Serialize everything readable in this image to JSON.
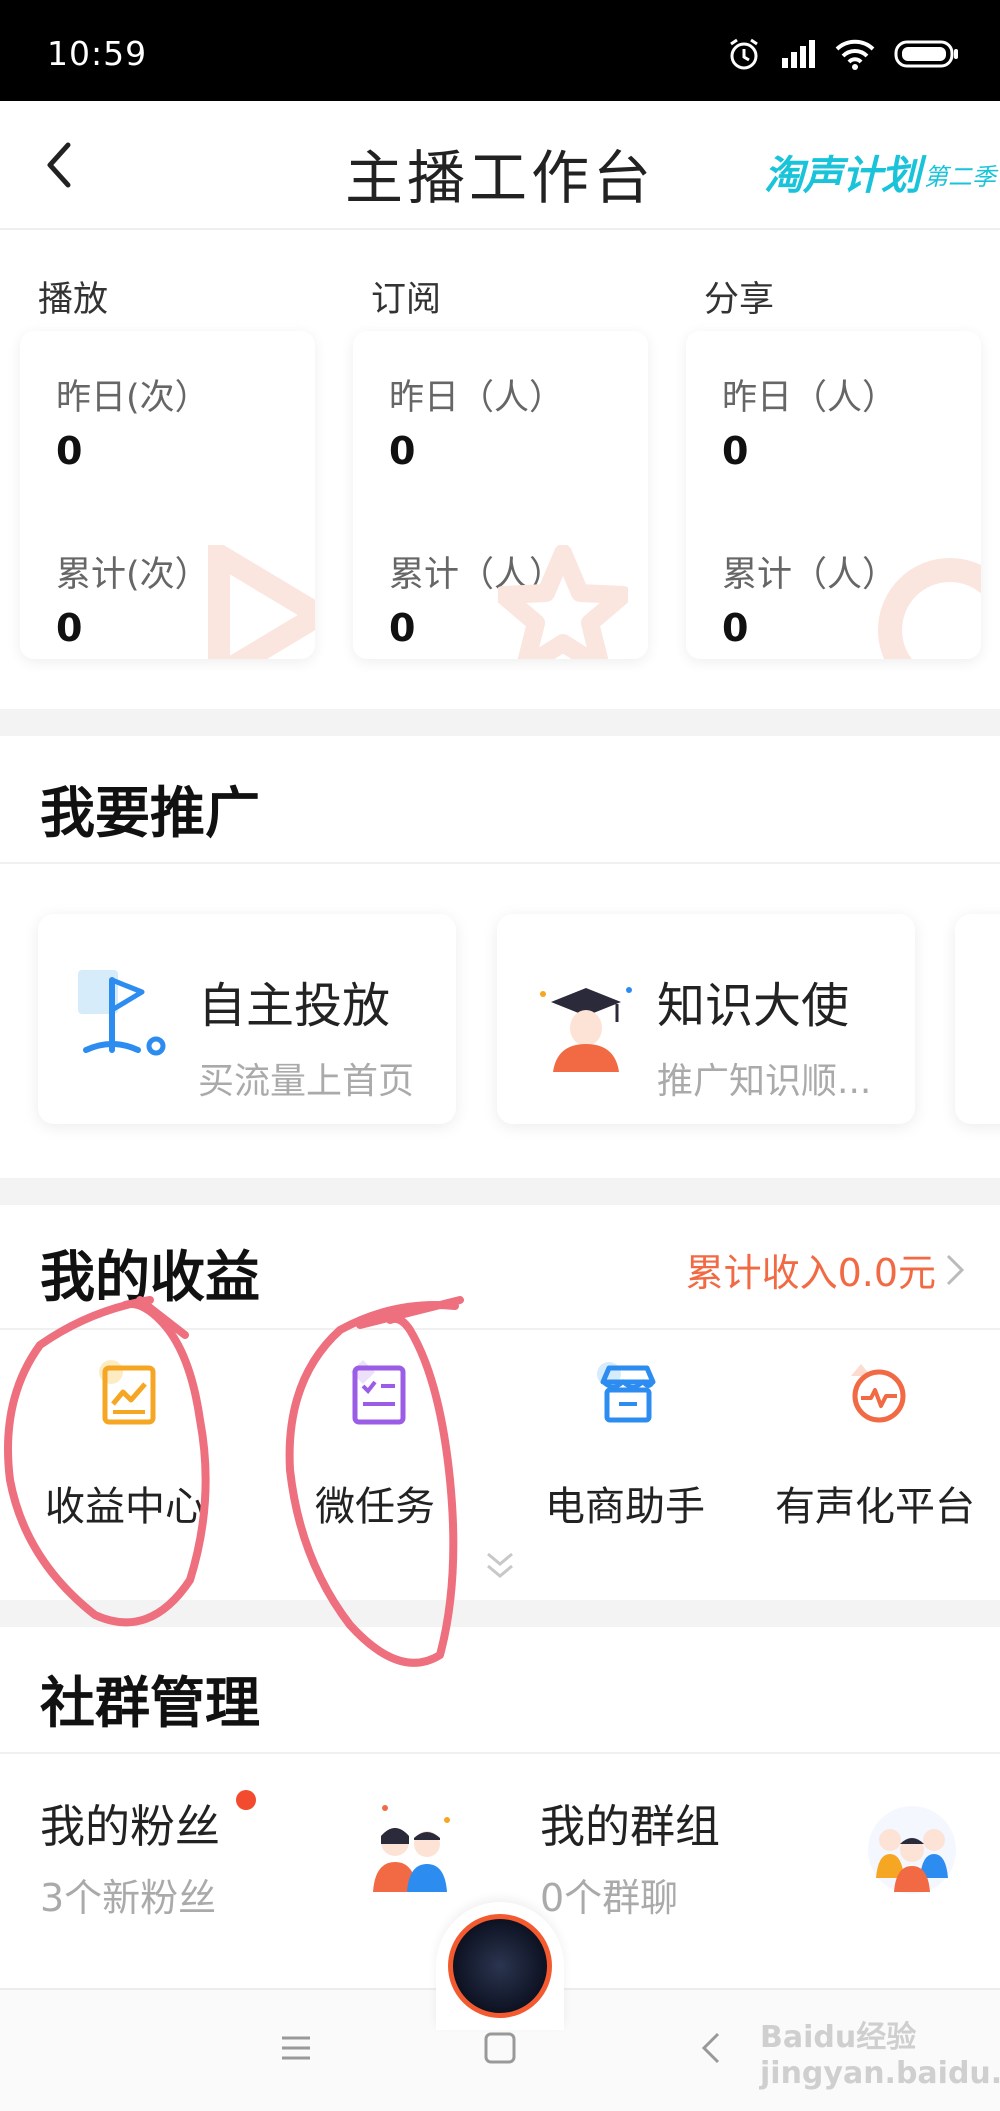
{
  "status_bar": {
    "time": "10:59"
  },
  "header": {
    "title": "主播工作台",
    "promo_main": "淘声计划",
    "promo_sub": "第二季"
  },
  "stats": {
    "columns": [
      {
        "heading": "播放",
        "yesterday_label": "昨日(次）",
        "yesterday_value": "0",
        "total_label": "累计(次）",
        "total_value": "0"
      },
      {
        "heading": "订阅",
        "yesterday_label": "昨日（人）",
        "yesterday_value": "0",
        "total_label": "累计（人）",
        "total_value": "0"
      },
      {
        "heading": "分享",
        "yesterday_label": "昨日（人）",
        "yesterday_value": "0",
        "total_label": "累计（人）",
        "total_value": "0"
      }
    ]
  },
  "promotion": {
    "title": "我要推广",
    "cards": [
      {
        "title": "自主投放",
        "subtitle": "买流量上首页",
        "icon": "flag-icon"
      },
      {
        "title": "知识大使",
        "subtitle": "推广知识顺...",
        "icon": "graduate-icon"
      }
    ]
  },
  "income": {
    "title": "我的收益",
    "total_link": "累计收入0.0元",
    "tools": [
      {
        "label": "收益中心",
        "icon": "income-chart-icon",
        "color": "#f5a623"
      },
      {
        "label": "微任务",
        "icon": "checklist-icon",
        "color": "#9b5de5"
      },
      {
        "label": "电商助手",
        "icon": "shop-icon",
        "color": "#2d8cf0"
      },
      {
        "label": "有声化平台",
        "icon": "pulse-icon",
        "color": "#f26a43"
      }
    ]
  },
  "community": {
    "title": "社群管理",
    "fans_title": "我的粉丝",
    "fans_sub": "3个新粉丝",
    "groups_title": "我的群组",
    "groups_sub": "0个群聊"
  },
  "watermark": "Baidu经验 jingyan.baidu.com",
  "colors": {
    "accent": "#f26a43",
    "teal": "#19c3d9",
    "divider": "#f3f3f4",
    "annotation": "#f06a78"
  }
}
